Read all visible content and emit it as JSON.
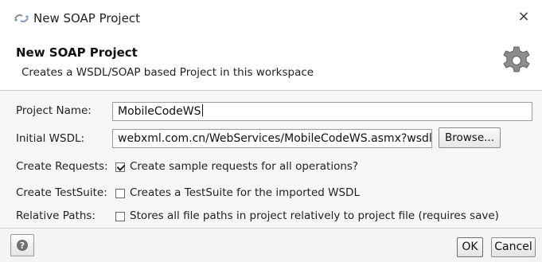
{
  "window": {
    "title": "New SOAP Project",
    "close_glyph": "×"
  },
  "banner": {
    "title": "New SOAP Project",
    "description": "Creates a WSDL/SOAP based Project in this workspace",
    "icon": "gear-icon"
  },
  "form": {
    "project_name": {
      "label": "Project Name:",
      "value": "MobileCodeWS"
    },
    "initial_wsdl": {
      "label": "Initial WSDL:",
      "value": "webxml.com.cn/WebServices/MobileCodeWS.asmx?wsdl",
      "browse_label": "Browse..."
    },
    "create_requests": {
      "label": "Create Requests:",
      "checked": true,
      "text": "Create sample requests for all operations?"
    },
    "create_testsuite": {
      "label": "Create TestSuite:",
      "checked": false,
      "text": "Creates a TestSuite for the imported WSDL"
    },
    "relative_paths": {
      "label": "Relative Paths:",
      "checked": false,
      "text": "Stores all file paths in project relatively to project file (requires save)"
    }
  },
  "footer": {
    "help_icon": "help-icon",
    "ok_label": "OK",
    "cancel_label": "Cancel"
  },
  "colors": {
    "background": "#f4f4f4",
    "banner_background": "#ffffff",
    "border": "#9a9a9a"
  }
}
